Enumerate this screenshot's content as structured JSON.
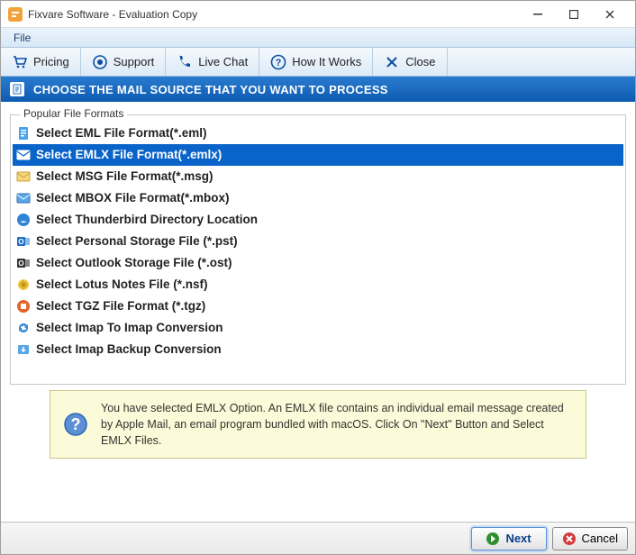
{
  "window": {
    "title": "Fixvare Software - Evaluation Copy"
  },
  "menubar": {
    "file": "File"
  },
  "toolbar": {
    "pricing": "Pricing",
    "support": "Support",
    "live_chat": "Live Chat",
    "how_it_works": "How It Works",
    "close": "Close"
  },
  "banner": {
    "text": "CHOOSE THE MAIL SOURCE THAT YOU WANT TO PROCESS"
  },
  "formats": {
    "group_label": "Popular File Formats",
    "items": [
      {
        "label": "Select EML File Format(*.eml)",
        "icon": "file-blue",
        "selected": false
      },
      {
        "label": "Select EMLX File Format(*.emlx)",
        "icon": "mail-white",
        "selected": true
      },
      {
        "label": "Select MSG File Format(*.msg)",
        "icon": "mail-yellow",
        "selected": false
      },
      {
        "label": "Select MBOX File Format(*.mbox)",
        "icon": "mail-blue",
        "selected": false
      },
      {
        "label": "Select Thunderbird Directory Location",
        "icon": "thunderbird",
        "selected": false
      },
      {
        "label": "Select Personal Storage File (*.pst)",
        "icon": "outlook",
        "selected": false
      },
      {
        "label": "Select Outlook Storage File (*.ost)",
        "icon": "outlook-dark",
        "selected": false
      },
      {
        "label": "Select Lotus Notes File (*.nsf)",
        "icon": "lotus",
        "selected": false
      },
      {
        "label": "Select TGZ File Format (*.tgz)",
        "icon": "tgz",
        "selected": false
      },
      {
        "label": "Select Imap To Imap Conversion",
        "icon": "sync",
        "selected": false
      },
      {
        "label": "Select Imap Backup Conversion",
        "icon": "backup",
        "selected": false
      }
    ]
  },
  "info": {
    "text": "You have selected EMLX Option. An EMLX file contains an individual email message created by Apple Mail, an email program bundled with macOS. Click On \"Next\" Button and Select EMLX Files."
  },
  "footer": {
    "next": "Next",
    "cancel": "Cancel"
  },
  "colors": {
    "selection": "#0a63c9",
    "banner_top": "#2a7bd0",
    "banner_bottom": "#0e5bb0",
    "info_bg": "#fbfbd9"
  }
}
